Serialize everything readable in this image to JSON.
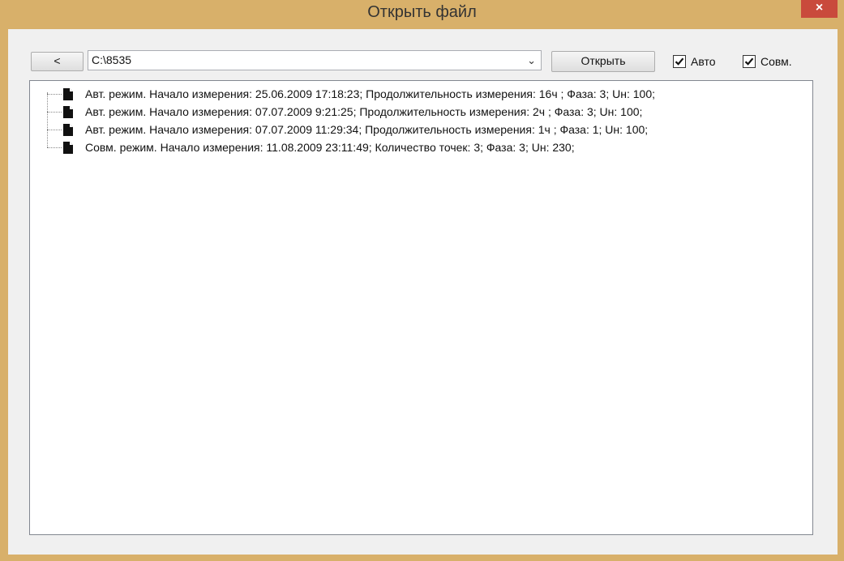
{
  "window": {
    "title": "Открыть файл",
    "close_label": "×"
  },
  "toolbar": {
    "back_label": "<",
    "path_value": "C:\\8535",
    "dropdown_glyph": "⌄",
    "open_label": "Открыть",
    "auto_label": "Авто",
    "auto_checked": true,
    "sovm_label": "Совм.",
    "sovm_checked": true
  },
  "tree": {
    "items": [
      {
        "label": "Авт. режим. Начало измерения: 25.06.2009 17:18:23; Продолжительность измерения: 16ч ; Фаза: 3; Uн: 100;",
        "icon": "file-icon"
      },
      {
        "label": "Авт. режим. Начало измерения: 07.07.2009 9:21:25; Продолжительность измерения: 2ч ; Фаза: 3; Uн: 100;",
        "icon": "file-icon"
      },
      {
        "label": "Авт. режим. Начало измерения: 07.07.2009 11:29:34; Продолжительность измерения: 1ч ; Фаза: 1; Uн: 100;",
        "icon": "file-icon"
      },
      {
        "label": "Совм. режим. Начало измерения: 11.08.2009 23:11:49; Количество точек: 3; Фаза: 3; Uн: 230;",
        "icon": "file-icon"
      }
    ]
  },
  "colors": {
    "title_bar": "#d8b06a",
    "close_button": "#c94a3c",
    "client_bg": "#f0f0f0"
  }
}
